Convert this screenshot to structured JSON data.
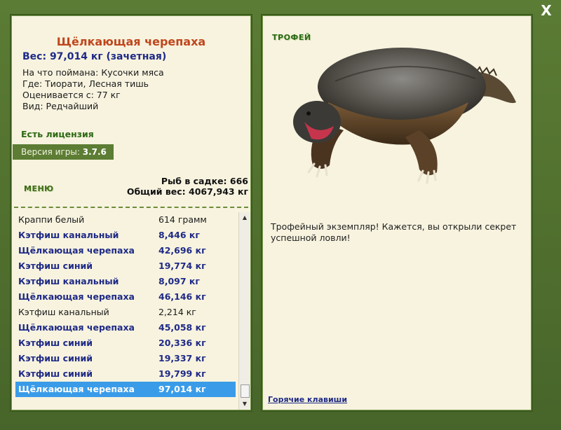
{
  "close_label": "X",
  "fish": {
    "title": "Щёлкающая черепаха",
    "weight": "Вес: 97,014 кг (зачетная)",
    "bait": "На что поймана: Кусочки мяса",
    "place": "Где: Тиорати, Лесная тишь",
    "price": "Оценивается с: 77 кг",
    "kind": "Вид: Редчайший"
  },
  "license": "Есть лицензия",
  "version": {
    "label": "Версия игры: ",
    "value": "3.7.6"
  },
  "menu_label": "МЕНЮ",
  "stats": {
    "fish_count": "Рыб в садке: 666",
    "total_weight": "Общий вес: 4067,943 кг"
  },
  "catch_list": [
    {
      "name": "Краппи белый",
      "weight": "614 грамм",
      "bold": false
    },
    {
      "name": "Кэтфиш канальный",
      "weight": "8,446 кг",
      "bold": true
    },
    {
      "name": "Щёлкающая черепаха",
      "weight": "42,696 кг",
      "bold": true
    },
    {
      "name": "Кэтфиш синий",
      "weight": "19,774 кг",
      "bold": true
    },
    {
      "name": "Кэтфиш канальный",
      "weight": "8,097 кг",
      "bold": true
    },
    {
      "name": "Щёлкающая черепаха",
      "weight": "46,146 кг",
      "bold": true
    },
    {
      "name": "Кэтфиш канальный",
      "weight": "2,214 кг",
      "bold": false
    },
    {
      "name": "Щёлкающая черепаха",
      "weight": "45,058 кг",
      "bold": true
    },
    {
      "name": "Кэтфиш синий",
      "weight": "20,336 кг",
      "bold": true
    },
    {
      "name": "Кэтфиш синий",
      "weight": "19,337 кг",
      "bold": true
    },
    {
      "name": "Кэтфиш синий",
      "weight": "19,799 кг",
      "bold": true
    },
    {
      "name": "Щёлкающая черепаха",
      "weight": "97,014 кг",
      "bold": true,
      "selected": true
    }
  ],
  "trophy": {
    "label": "ТРОФЕЙ",
    "text": "Трофейный экземпляр! Кажется, вы открыли секрет успешной ловли!",
    "hotkeys": "Горячие клавиши"
  },
  "colors": {
    "frame": "#4f6e2e",
    "panel": "#f7f3df",
    "title": "#c0461c",
    "bold_text": "#1f2a86",
    "selection": "#3a9ce8"
  },
  "icons": {
    "close": "close-icon",
    "scroll_up": "arrow-up-icon",
    "scroll_down": "arrow-down-icon"
  }
}
